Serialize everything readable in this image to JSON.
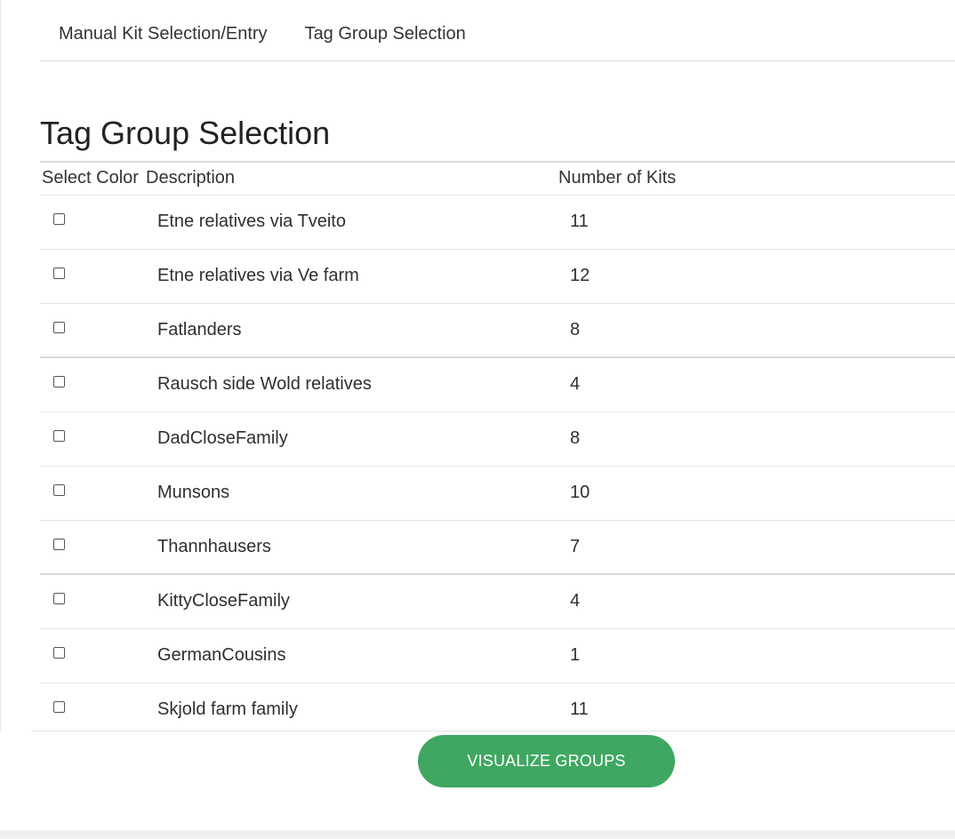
{
  "tabs": [
    {
      "label": "Manual Kit Selection/Entry"
    },
    {
      "label": "Tag Group Selection"
    }
  ],
  "page_title": "Tag Group Selection",
  "table": {
    "headers": {
      "select_color": "Select Color",
      "description": "Description",
      "number_of_kits": "Number of Kits"
    },
    "rows": [
      {
        "description": "Etne relatives via Tveito",
        "kits": "11",
        "checked": false
      },
      {
        "description": "Etne relatives via Ve farm",
        "kits": "12",
        "checked": false
      },
      {
        "description": "Fatlanders",
        "kits": "8",
        "checked": false
      },
      {
        "description": "Rausch side Wold relatives",
        "kits": "4",
        "checked": false
      },
      {
        "description": "DadCloseFamily",
        "kits": "8",
        "checked": false
      },
      {
        "description": "Munsons",
        "kits": "10",
        "checked": false
      },
      {
        "description": "Thannhausers",
        "kits": "7",
        "checked": false
      },
      {
        "description": "KittyCloseFamily",
        "kits": "4",
        "checked": false
      },
      {
        "description": "GermanCousins",
        "kits": "1",
        "checked": false
      },
      {
        "description": "Skjold farm family",
        "kits": "11",
        "checked": false
      }
    ]
  },
  "visualize_button": {
    "label": "VISUALIZE GROUPS"
  },
  "colors": {
    "accent": "#3fa762",
    "text": "#2f2f2f",
    "divider": "#e6e6e6"
  }
}
